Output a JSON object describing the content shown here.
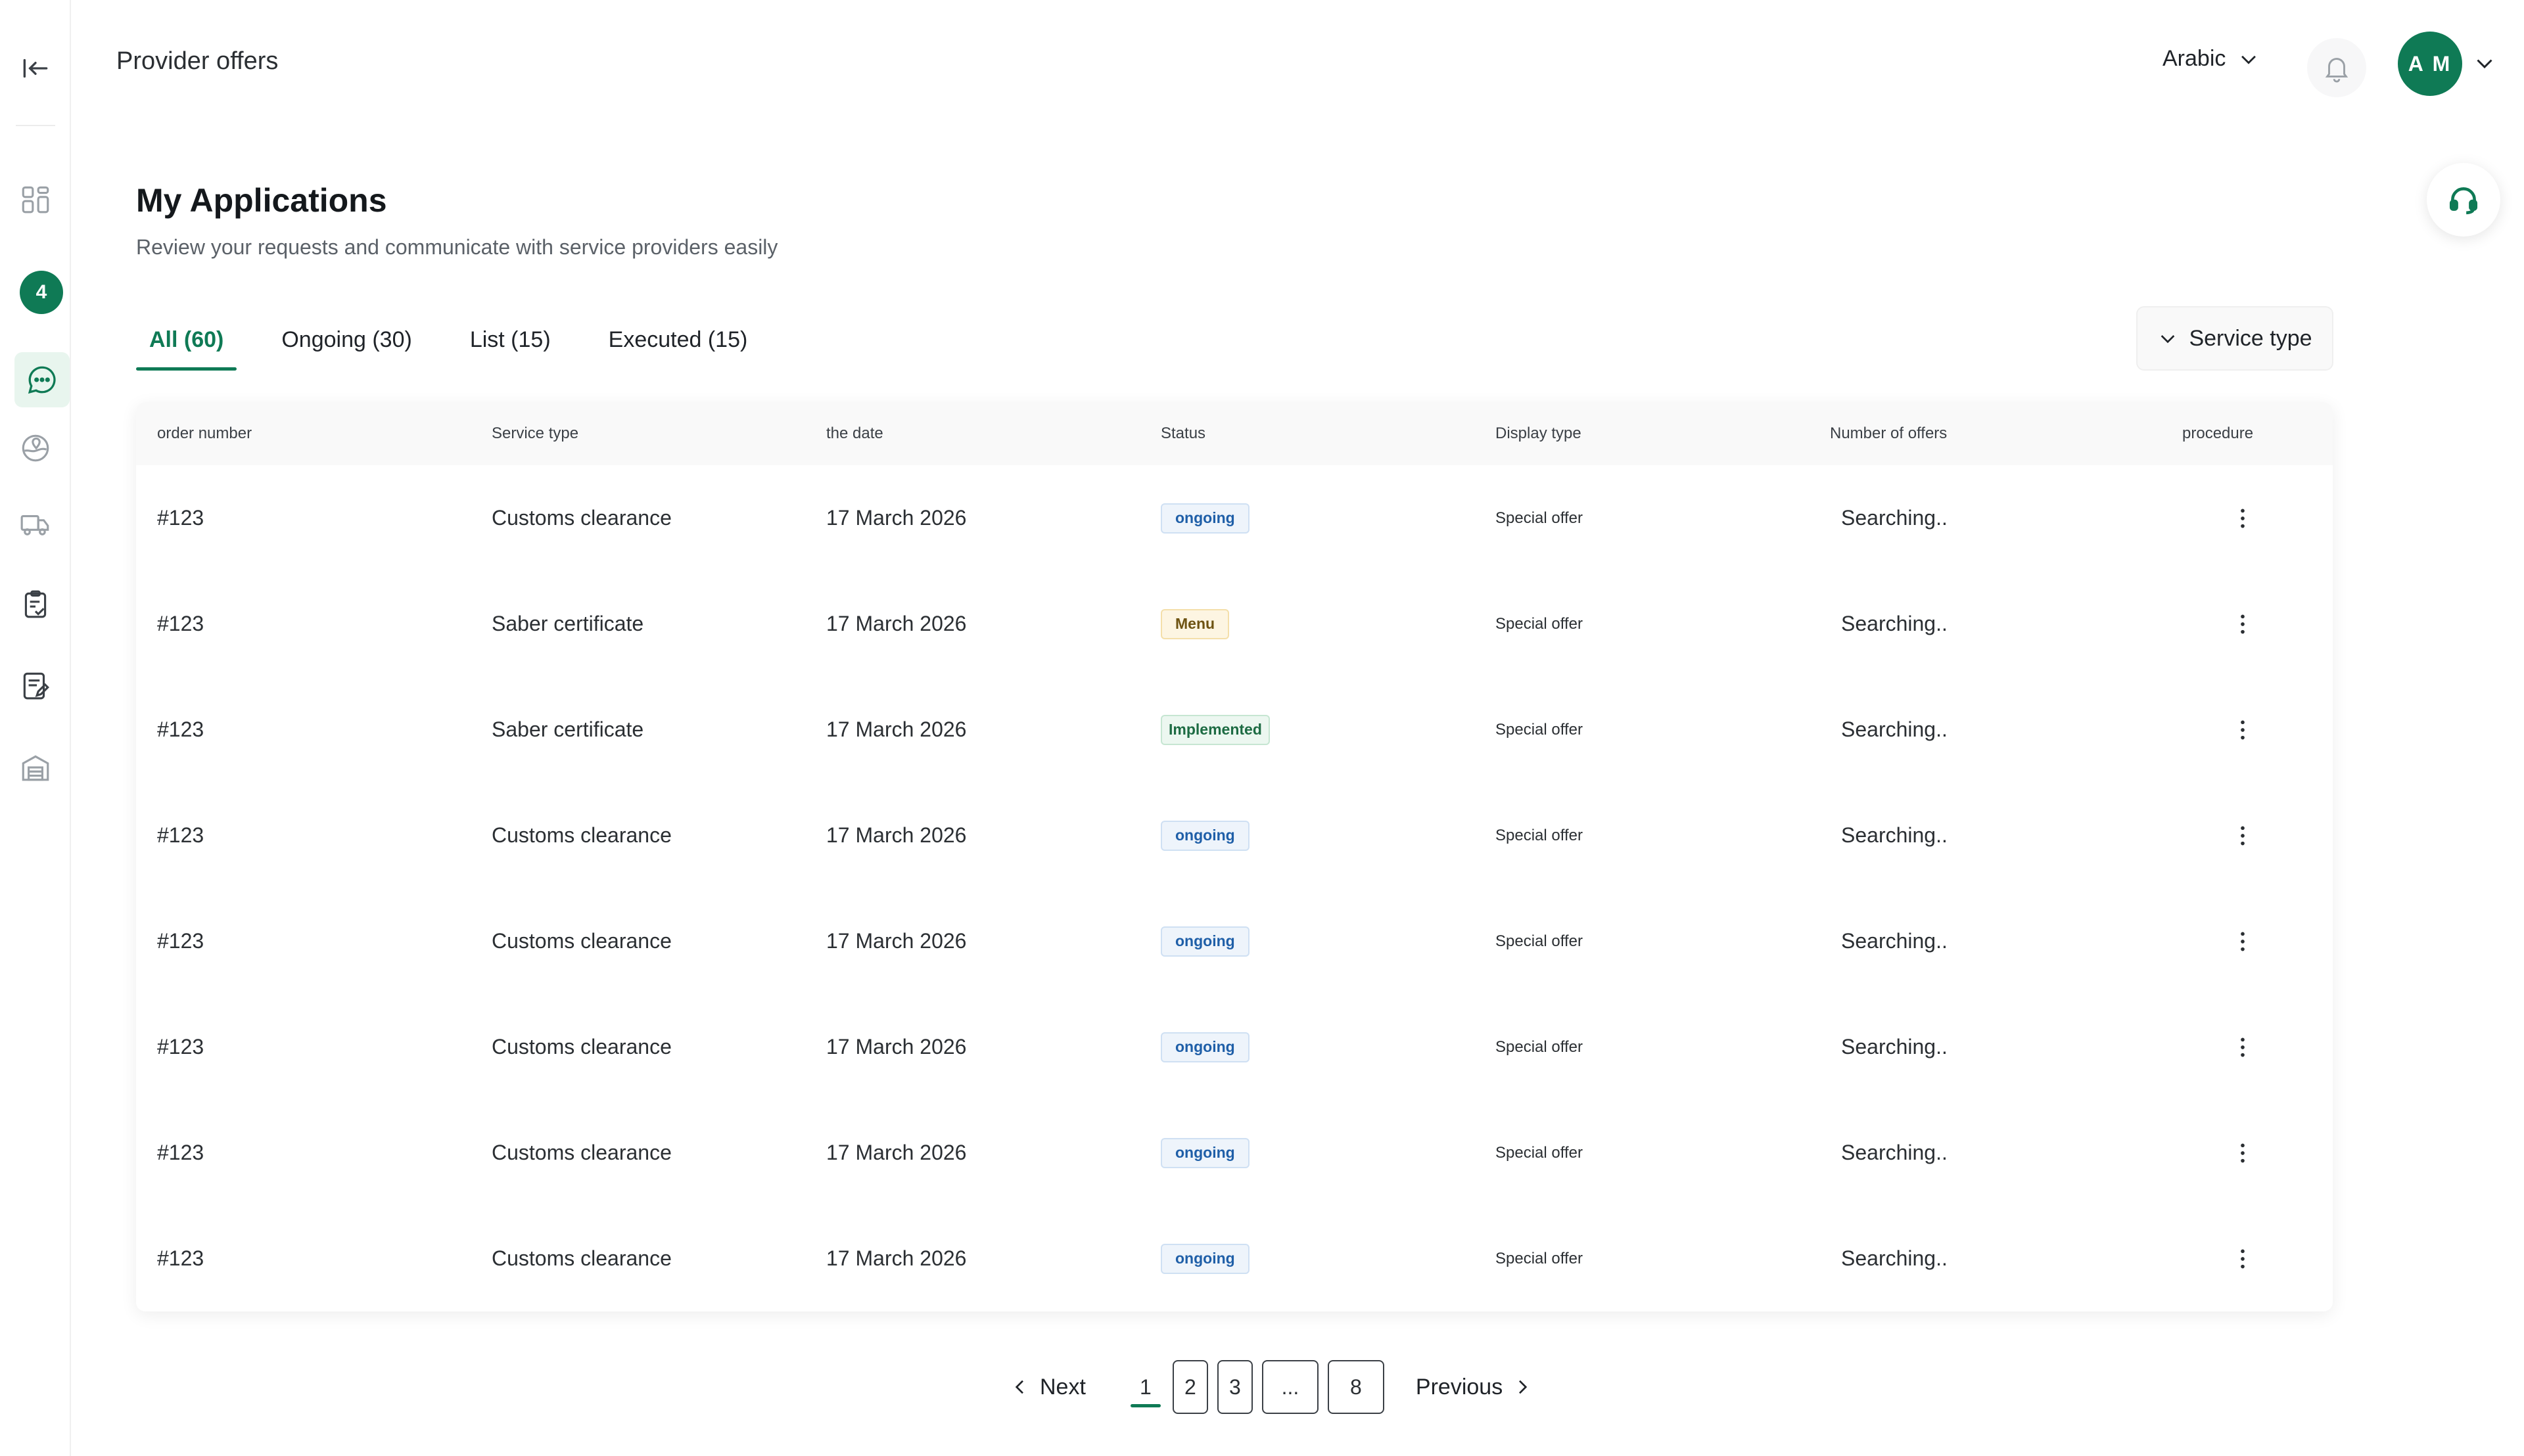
{
  "topbar": {
    "title": "Provider offers",
    "language": "Arabic",
    "avatar_initials": "A M"
  },
  "sidebar": {
    "badge_count": "4",
    "items": [
      {
        "name": "collapse-icon"
      },
      {
        "name": "dashboard-icon"
      },
      {
        "name": "chat-icon",
        "active": true
      },
      {
        "name": "location-icon"
      },
      {
        "name": "truck-icon"
      },
      {
        "name": "checklist-icon"
      },
      {
        "name": "document-edit-icon"
      },
      {
        "name": "warehouse-icon"
      }
    ]
  },
  "page": {
    "title": "My Applications",
    "subtitle": "Review your requests and communicate with service providers easily"
  },
  "tabs": [
    {
      "label": "All (60)",
      "active": true
    },
    {
      "label": "Ongoing (30)"
    },
    {
      "label": "List (15)"
    },
    {
      "label": "Executed (15)"
    }
  ],
  "filter": {
    "label": "Service type"
  },
  "table": {
    "headers": [
      "order number",
      "Service type",
      "the date",
      "Status",
      "Display type",
      "Number of offers",
      "procedure"
    ],
    "rows": [
      {
        "order": "#123",
        "service": "Customs clearance",
        "date": "17 March 2026",
        "status": "ongoing",
        "status_kind": "ongoing",
        "display": "Special offer",
        "offers": "Searching.."
      },
      {
        "order": "#123",
        "service": "Saber certificate",
        "date": "17 March 2026",
        "status": "Menu",
        "status_kind": "menu",
        "display": "Special offer",
        "offers": "Searching.."
      },
      {
        "order": "#123",
        "service": "Saber certificate",
        "date": "17 March 2026",
        "status": "Implemented",
        "status_kind": "implemented",
        "display": "Special offer",
        "offers": "Searching.."
      },
      {
        "order": "#123",
        "service": "Customs clearance",
        "date": "17 March 2026",
        "status": "ongoing",
        "status_kind": "ongoing",
        "display": "Special offer",
        "offers": "Searching.."
      },
      {
        "order": "#123",
        "service": "Customs clearance",
        "date": "17 March 2026",
        "status": "ongoing",
        "status_kind": "ongoing",
        "display": "Special offer",
        "offers": "Searching.."
      },
      {
        "order": "#123",
        "service": "Customs clearance",
        "date": "17 March 2026",
        "status": "ongoing",
        "status_kind": "ongoing",
        "display": "Special offer",
        "offers": "Searching.."
      },
      {
        "order": "#123",
        "service": "Customs clearance",
        "date": "17 March 2026",
        "status": "ongoing",
        "status_kind": "ongoing",
        "display": "Special offer",
        "offers": "Searching.."
      },
      {
        "order": "#123",
        "service": "Customs clearance",
        "date": "17 March 2026",
        "status": "ongoing",
        "status_kind": "ongoing",
        "display": "Special offer",
        "offers": "Searching.."
      }
    ]
  },
  "pagination": {
    "next_label": "Next",
    "previous_label": "Previous",
    "pages": [
      "1",
      "2",
      "3",
      "...",
      "8"
    ],
    "current": "1"
  },
  "colors": {
    "brand": "#0f7a55",
    "ongoing": "#1f5fa8",
    "menu": "#6e5312",
    "implemented": "#1d6b43"
  }
}
